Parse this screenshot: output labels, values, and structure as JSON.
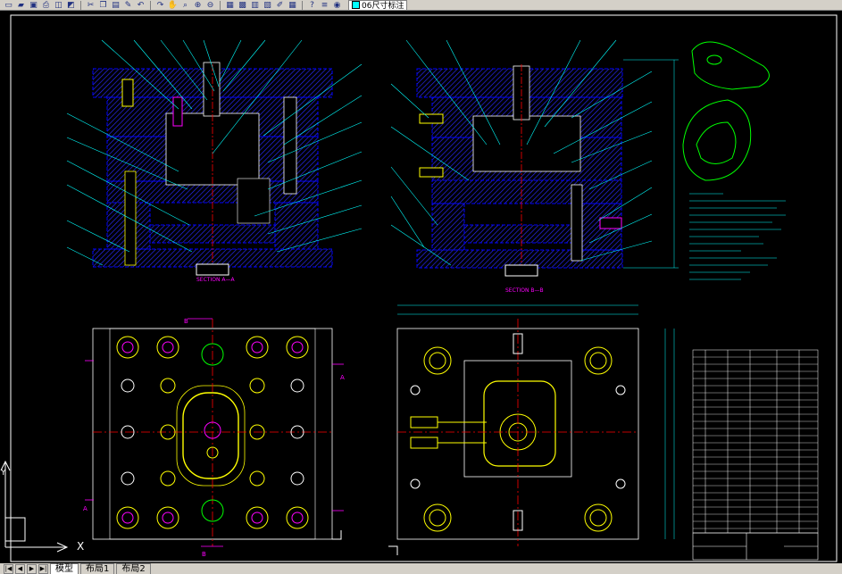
{
  "toolbar": {
    "icons": [
      "new-icon",
      "open-icon",
      "save-icon",
      "print-icon",
      "preview-icon",
      "publish-icon",
      "cut-icon",
      "copy-icon",
      "paste-icon",
      "matchprop-icon",
      "undo-icon",
      "redo-icon",
      "pan-icon",
      "zoom-realtime-icon",
      "zoom-window-icon",
      "zoom-previous-icon",
      "properties-icon",
      "designcenter-icon",
      "toolpalettes-icon",
      "sheetset-icon",
      "markup-icon",
      "calc-icon",
      "help-icon",
      "layer-manager-icon",
      "layer-state-icon"
    ],
    "layer_name": "06尺寸标注"
  },
  "drawing": {
    "section_a_label": "SECTION A—A",
    "section_b_label": "SECTION B—B",
    "cut_label_a": "A",
    "cut_label_b": "B",
    "ucs_x": "X",
    "ucs_y": "Y",
    "colors": {
      "background": "#000000",
      "plate_outline": "#0000ff",
      "hatch": "#3030ff",
      "leader": "#00ffff",
      "yellow": "#ffff00",
      "magenta": "#ff00ff",
      "centerline": "#ff0000",
      "white": "#ffffff",
      "green": "#00ff00"
    }
  },
  "layout_tabs": [
    "模型",
    "布局1",
    "布局2"
  ],
  "active_tab": "模型"
}
